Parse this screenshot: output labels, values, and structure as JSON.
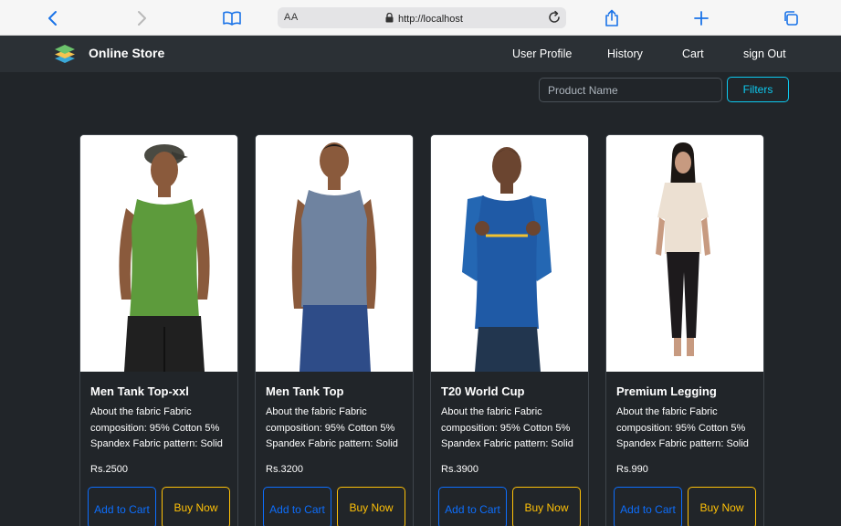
{
  "browser": {
    "aa_label": "AA",
    "url": "http://localhost"
  },
  "navbar": {
    "brand": "Online Store",
    "links": [
      "User Profile",
      "History",
      "Cart",
      "sign Out"
    ]
  },
  "search": {
    "placeholder": "Product Name",
    "filter_label": "Filters"
  },
  "products": [
    {
      "title": "Men Tank Top-xxl",
      "description": "About the fabric Fabric composition: 95% Cotton 5% Spandex Fabric pattern: Solid",
      "price": "Rs.2500",
      "add_to_cart": "Add to Cart",
      "buy_now": "Buy Now"
    },
    {
      "title": "Men Tank Top",
      "description": "About the fabric Fabric composition: 95% Cotton 5% Spandex Fabric pattern: Solid",
      "price": "Rs.3200",
      "add_to_cart": "Add to Cart",
      "buy_now": "Buy Now"
    },
    {
      "title": "T20 World Cup",
      "description": "About the fabric Fabric composition: 95% Cotton 5% Spandex Fabric pattern: Solid",
      "price": "Rs.3900",
      "add_to_cart": "Add to Cart",
      "buy_now": "Buy Now"
    },
    {
      "title": "Premium Legging",
      "description": "About the fabric Fabric composition: 95% Cotton 5% Spandex Fabric pattern: Solid",
      "price": "Rs.990",
      "add_to_cart": "Add to Cart",
      "buy_now": "Buy Now"
    }
  ],
  "colors": {
    "background": "#212529",
    "navbar": "#2b3035",
    "info": "#0dcaf0",
    "primary": "#0d6efd",
    "warning": "#ffc107"
  }
}
